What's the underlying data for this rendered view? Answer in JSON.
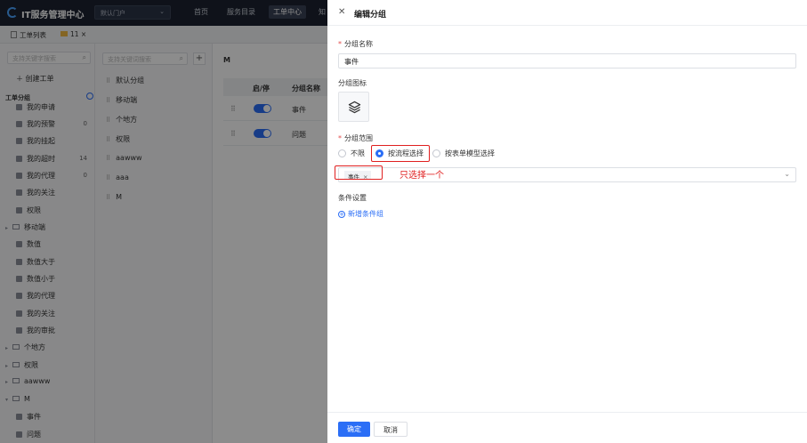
{
  "app": {
    "title": "IT服务管理中心",
    "portal_select": "默认门户",
    "nav": [
      "首页",
      "服务目录",
      "工单中心",
      "知"
    ]
  },
  "tabs": [
    {
      "label": "工单列表"
    },
    {
      "label": "11 ×"
    }
  ],
  "left_panel": {
    "search_placeholder": "支持关键字搜索",
    "create_label": "创建工单",
    "group_label": "工单分组",
    "items": [
      {
        "label": "我的申请",
        "count": ""
      },
      {
        "label": "我的预警",
        "count": "0"
      },
      {
        "label": "我的挂起",
        "count": ""
      },
      {
        "label": "我的超时",
        "count": "14"
      },
      {
        "label": "我的代理",
        "count": "0"
      },
      {
        "label": "我的关注",
        "count": ""
      },
      {
        "label": "权限",
        "count": ""
      },
      {
        "label": "移动端",
        "count": "",
        "folder": true
      },
      {
        "label": "数值",
        "count": ""
      },
      {
        "label": "数值大于",
        "count": ""
      },
      {
        "label": "数值小于",
        "count": ""
      },
      {
        "label": "我的代理",
        "count": ""
      },
      {
        "label": "我的关注",
        "count": ""
      },
      {
        "label": "我的审批",
        "count": ""
      },
      {
        "label": "个地方",
        "count": "",
        "folder": true
      },
      {
        "label": "权限",
        "count": "",
        "folder": true
      },
      {
        "label": "aawww",
        "count": "",
        "folder": true
      },
      {
        "label": "M",
        "count": "",
        "folder": true
      },
      {
        "label": "事件",
        "count": ""
      },
      {
        "label": "问题",
        "count": ""
      }
    ]
  },
  "group_panel": {
    "search_placeholder": "支持关键词搜索",
    "add_label": "+",
    "items": [
      "默认分组",
      "移动端",
      "个地方",
      "权限",
      "aawww",
      "aaa",
      "M"
    ]
  },
  "main": {
    "title": "M",
    "columns": [
      "启/停",
      "分组名称"
    ],
    "rows": [
      {
        "name": "事件"
      },
      {
        "name": "问题"
      }
    ]
  },
  "drawer": {
    "title": "编辑分组",
    "name_label": "分组名称",
    "name_value": "事件",
    "icon_label": "分组图标",
    "scope_label": "分组范围",
    "radios": [
      "不限",
      "按流程选择",
      "按表单模型选择"
    ],
    "selected_radio": "按流程选择",
    "chip_label": "事件",
    "chip_remove": "×",
    "annotation": "只选择一个",
    "condition_label": "条件设置",
    "add_condition": "新增条件组",
    "ok_label": "确定",
    "cancel_label": "取消"
  },
  "colors": {
    "primary": "#2b6ef6",
    "annotation": "#e02020",
    "topbar": "#1c2230"
  }
}
